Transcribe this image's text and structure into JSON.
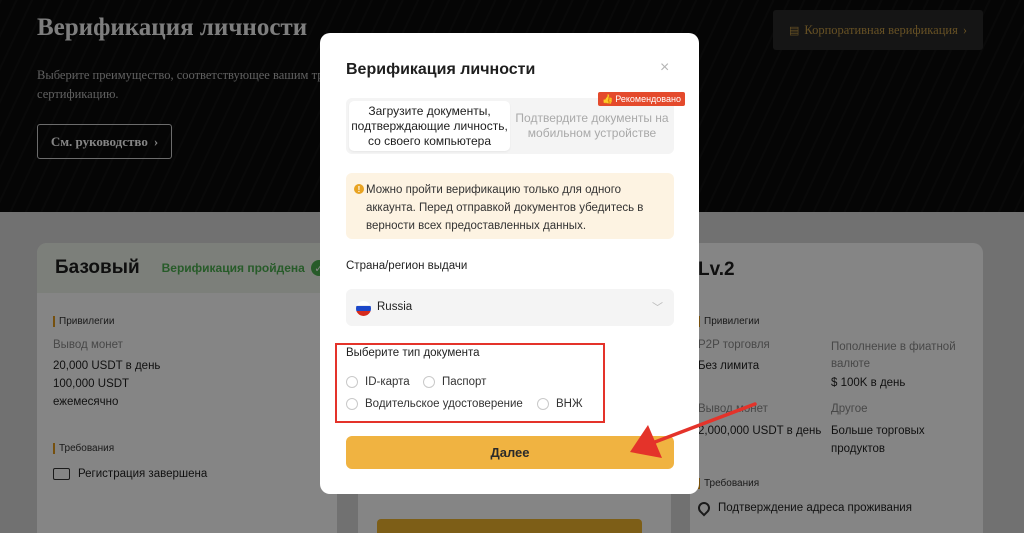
{
  "hero": {
    "title": "Верификация личности",
    "subtitle": "Выберите преимущество, соответствующее вашим тр... сертификацию.",
    "guide_button": "См. руководство",
    "guide_chevron": "›",
    "corporate_button": "Корпоративная верификация",
    "corporate_chevron": "›"
  },
  "cards": {
    "basic": {
      "title": "Базовый",
      "status": "Верификация пройдена",
      "privileges_label": "Привилегии",
      "withdraw_label": "Вывод монет",
      "withdraw_value": "20,000 USDT в день 100,000 USDT ежемесячно",
      "requirements_label": "Требования",
      "requirement": "Регистрация завершена"
    },
    "lv2": {
      "title": "Lv.2",
      "privileges_label": "Привилегии",
      "p2p_label": "P2P торговля",
      "p2p_value": "Без лимита",
      "fiat_label": "Пополнение в фиатной валюте",
      "fiat_value": "$ 100K в день",
      "withdraw_label": "Вывод монет",
      "withdraw_value": "2,000,000 USDT в день",
      "other_label": "Другое",
      "other_value": "Больше торговых продуктов",
      "requirements_label": "Требования",
      "requirement": "Подтверждение адреса проживания"
    }
  },
  "modal": {
    "title": "Верификация личности",
    "close": "×",
    "tabs": [
      {
        "label": "Загрузите документы, подтверждающие личность, со своего компьютера"
      },
      {
        "label": "Подтвердите документы на мобильном устройстве"
      }
    ],
    "recommended_badge": "Рекомендовано",
    "warning": "Можно пройти верификацию только для одного аккаунта. Перед отправкой документов убедитесь в верности всех предоставленных данных.",
    "region_label": "Страна/регион выдачи",
    "region_value": "Russia",
    "doc_type_label": "Выберите тип документа",
    "doc_types": [
      "ID-карта",
      "Паспорт",
      "Водительское удостоверение",
      "ВНЖ"
    ],
    "next_button": "Далее"
  },
  "colors": {
    "accent": "#f0b341",
    "annotation": "#e4332a",
    "success": "#4caf50",
    "badge": "#e44a2c"
  }
}
